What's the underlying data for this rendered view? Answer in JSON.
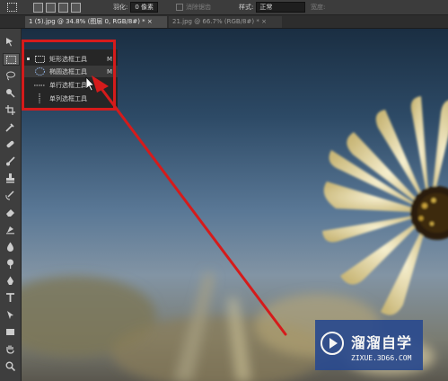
{
  "options_bar": {
    "feather_label": "羽化:",
    "feather_value": "0 像素",
    "antialias_label": "消除锯齿",
    "style_label": "样式:",
    "style_value": "正常",
    "width_label": "宽度:"
  },
  "tabs": [
    {
      "label": "1 (5).jpg @ 34.8% (图层 0, RGB/8#) *",
      "close": "×",
      "active": true
    },
    {
      "label": "21.jpg @ 66.7% (RGB/8#) *",
      "close": "×",
      "active": false
    }
  ],
  "toolbar_tools": [
    "move-icon",
    "marquee-icon",
    "lasso-icon",
    "quick-select-icon",
    "crop-icon",
    "eyedropper-icon",
    "healing-icon",
    "brush-icon",
    "stamp-icon",
    "history-brush-icon",
    "eraser-icon",
    "gradient-icon",
    "blur-icon",
    "dodge-icon",
    "pen-icon",
    "type-icon",
    "path-select-icon",
    "shape-icon",
    "hand-icon",
    "zoom-icon"
  ],
  "marquee_flyout": {
    "items": [
      {
        "icon": "rect-marquee-icon",
        "label": "矩形选框工具",
        "shortcut": "M",
        "active": true
      },
      {
        "icon": "ellipse-marquee-icon",
        "label": "椭圆选框工具",
        "shortcut": "M",
        "active": false
      },
      {
        "icon": "single-row-marquee-icon",
        "label": "单行选框工具",
        "shortcut": "",
        "active": false
      },
      {
        "icon": "single-col-marquee-icon",
        "label": "单列选框工具",
        "shortcut": "",
        "active": false
      }
    ]
  },
  "annotation": {
    "color": "#d51b1b"
  },
  "watermark": {
    "title": "溜溜自学",
    "subtitle": "ZIXUE.3D66.COM",
    "icon": "play-icon",
    "color": "#2a4a8e"
  }
}
